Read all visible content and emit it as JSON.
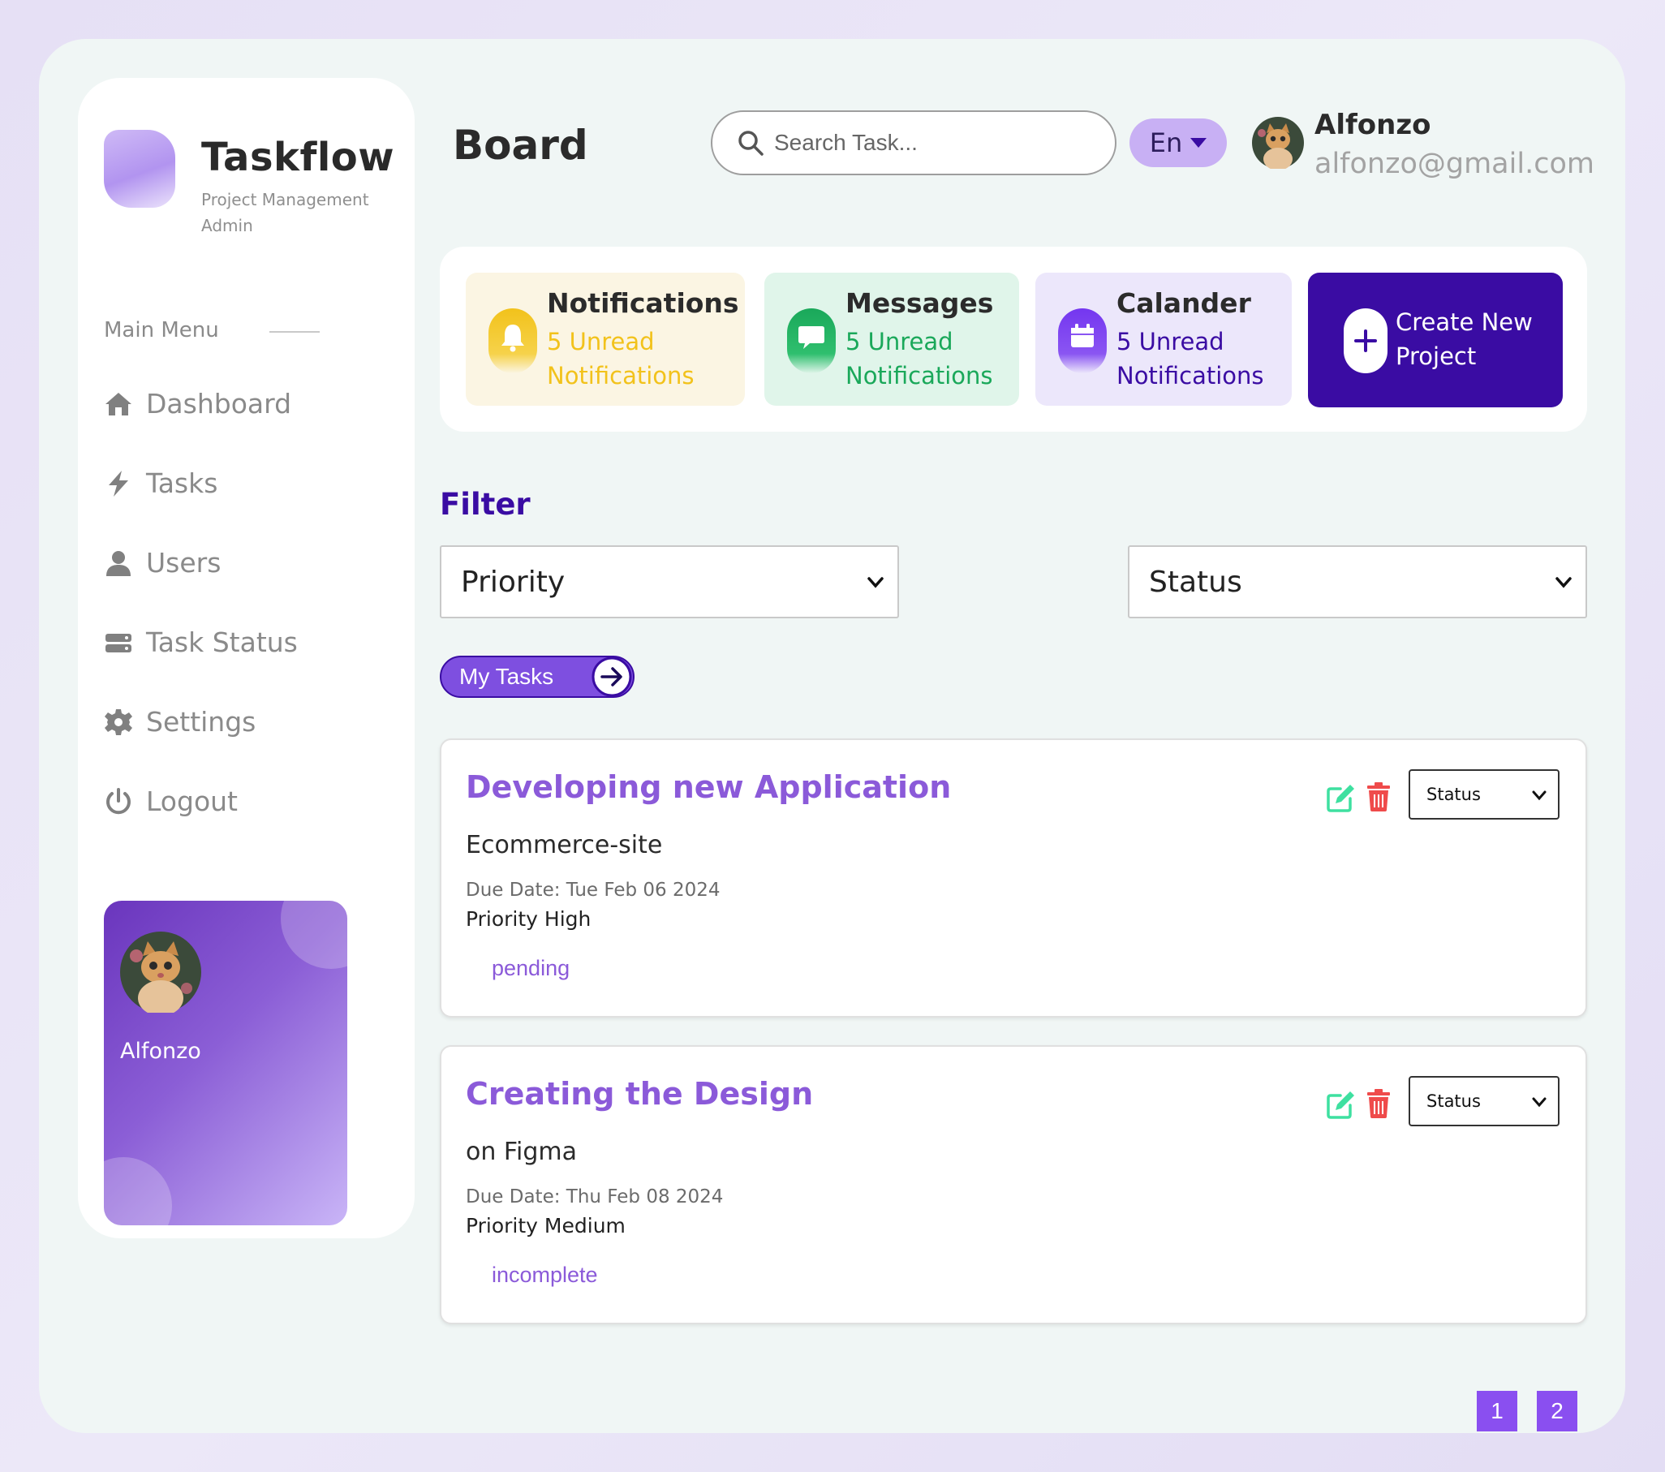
{
  "app": {
    "name": "Taskflow",
    "subtitle": "Project Management Admin"
  },
  "sidebar": {
    "menu_heading": "Main Menu",
    "items": [
      {
        "label": "Dashboard",
        "icon": "home-icon"
      },
      {
        "label": "Tasks",
        "icon": "bolt-icon"
      },
      {
        "label": "Users",
        "icon": "user-icon"
      },
      {
        "label": "Task Status",
        "icon": "server-icon"
      },
      {
        "label": "Settings",
        "icon": "gear-icon"
      },
      {
        "label": "Logout",
        "icon": "power-icon"
      }
    ],
    "profile_card": {
      "name": "Alfonzo"
    }
  },
  "header": {
    "title": "Board",
    "search_placeholder": "Search Task...",
    "language": "En",
    "user": {
      "name": "Alfonzo",
      "email": "alfonzo@gmail.com"
    }
  },
  "cards": [
    {
      "title": "Notifications",
      "text": "5 Unread Notifications",
      "icon": "bell-icon",
      "bg": "#fbf5e3",
      "accent": "#f2c21b"
    },
    {
      "title": "Messages",
      "text": "5 Unread Notifications",
      "icon": "message-icon",
      "bg": "#e0f5ea",
      "accent": "#1aa85a"
    },
    {
      "title": "Calander",
      "text": "5 Unread Notifications",
      "icon": "calendar-icon",
      "bg": "#ece7fb",
      "accent": "#7436f0"
    }
  ],
  "create_card": {
    "label": "Create New Project",
    "bg": "#3a0ca3"
  },
  "filter": {
    "title": "Filter",
    "priority_select": "Priority",
    "status_select": "Status",
    "my_tasks_label": "My Tasks"
  },
  "tasks": [
    {
      "title": "Developing new Application",
      "subtitle": "Ecommerce-site",
      "due": "Due Date: Tue Feb 06 2024",
      "priority": "Priority High",
      "status": "pending",
      "status_select": "Status"
    },
    {
      "title": "Creating the Design",
      "subtitle": "on Figma",
      "due": "Due Date: Thu Feb 08 2024",
      "priority": "Priority Medium",
      "status": "incomplete",
      "status_select": "Status"
    }
  ],
  "pagination": {
    "pages": [
      "1",
      "2"
    ]
  },
  "colors": {
    "primary": "#3a0ca3",
    "accent_purple": "#8b5ad9",
    "page_bg": "#f0f6f5"
  }
}
